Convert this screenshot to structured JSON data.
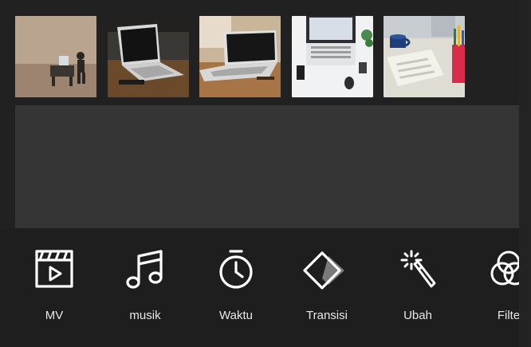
{
  "thumbnails": [
    {
      "name": "thumb-desk-figure",
      "desc_icon": "photo-thumbnail"
    },
    {
      "name": "thumb-laptop-dark",
      "desc_icon": "photo-thumbnail"
    },
    {
      "name": "thumb-laptop-wood",
      "desc_icon": "photo-thumbnail"
    },
    {
      "name": "thumb-laptop-topview",
      "desc_icon": "photo-thumbnail"
    },
    {
      "name": "thumb-keyboard-mug",
      "desc_icon": "photo-thumbnail"
    }
  ],
  "toolbar": {
    "items": [
      {
        "label": "MV",
        "icon": "clapperboard-icon"
      },
      {
        "label": "musik",
        "icon": "music-note-icon"
      },
      {
        "label": "Waktu",
        "icon": "stopwatch-icon"
      },
      {
        "label": "Transisi",
        "icon": "transition-icon"
      },
      {
        "label": "Ubah",
        "icon": "magic-wand-icon"
      },
      {
        "label": "Filte",
        "icon": "filter-circles-icon"
      }
    ]
  },
  "colors": {
    "background": "#212121",
    "preview": "#353535",
    "toolbar": "#1e1e1e",
    "icon": "#ffffff",
    "label": "#e8e8e8"
  }
}
